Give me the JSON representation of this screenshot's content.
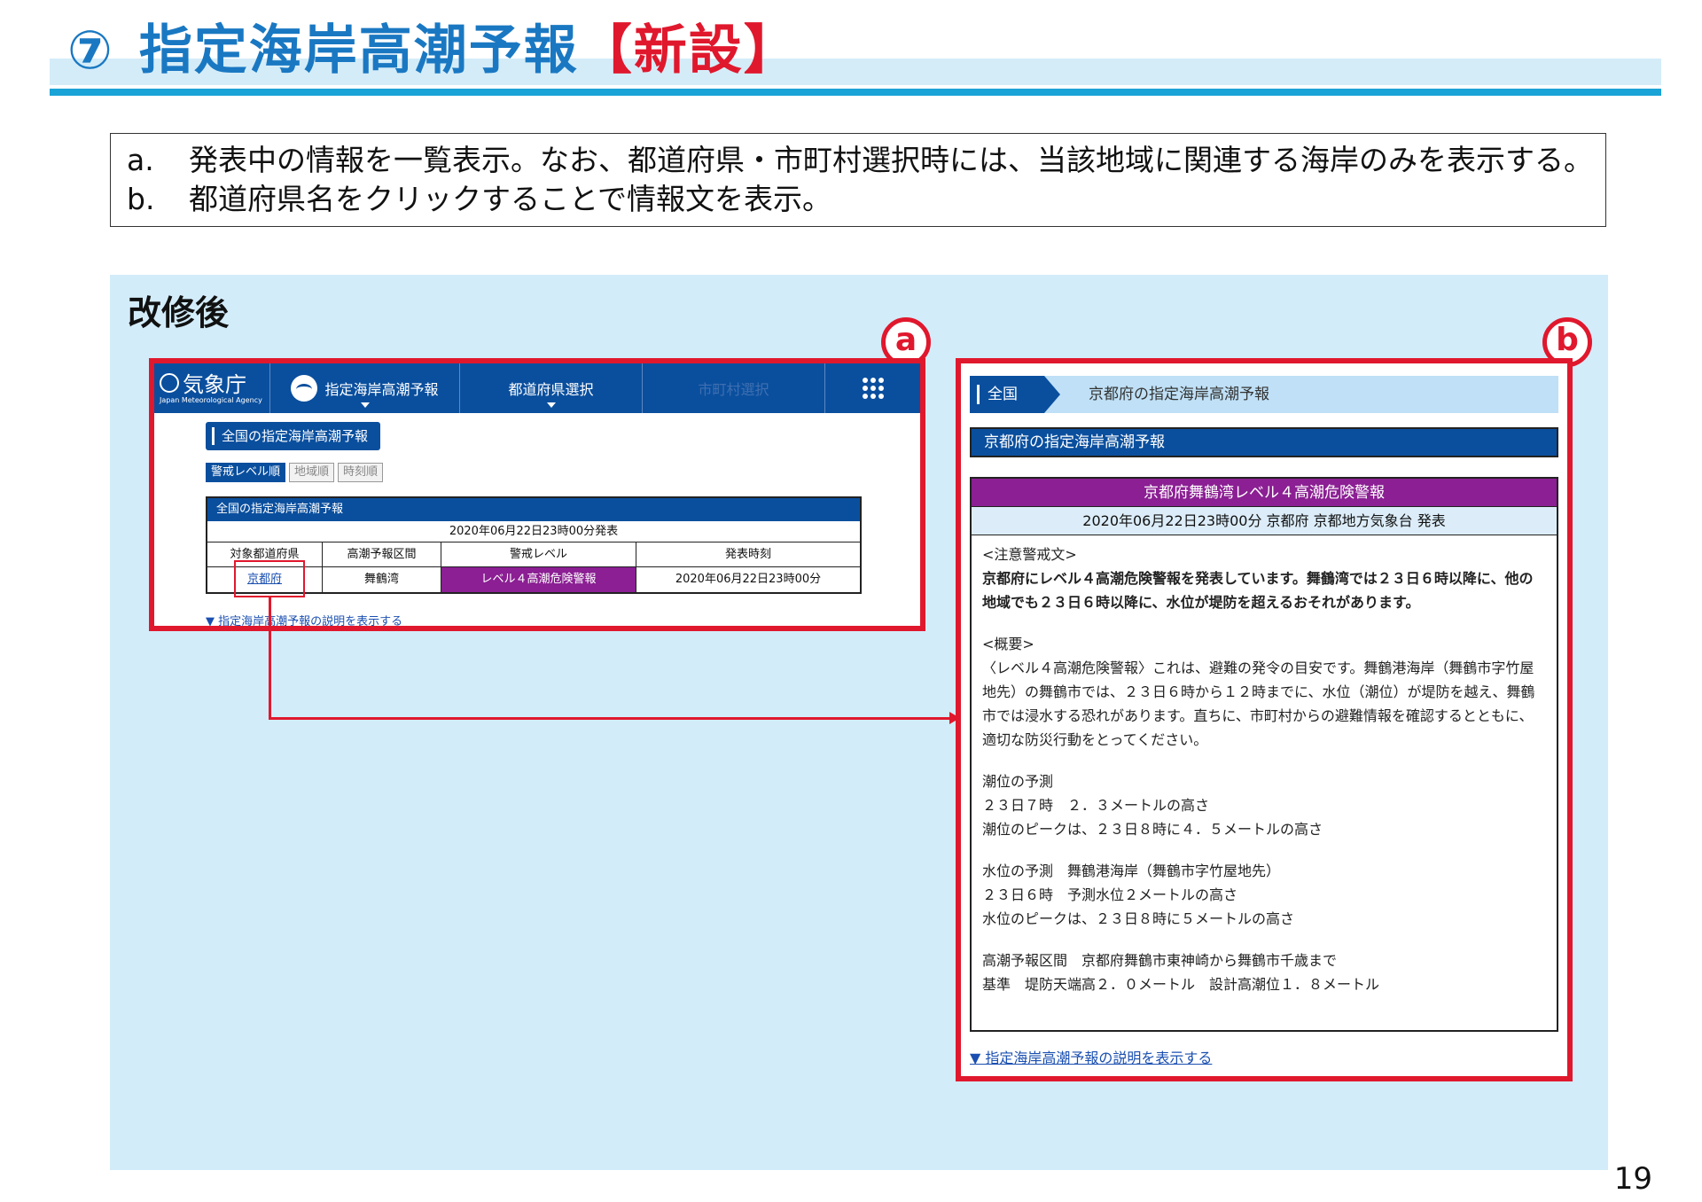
{
  "header": {
    "number": "⑦",
    "title": "指定海岸高潮予報",
    "tag": "【新設】"
  },
  "notes": [
    {
      "key": "a.",
      "text": "発表中の情報を一覧表示。なお、都道府県・市町村選択時には、当該地域に関連する海岸のみを表示する。"
    },
    {
      "key": "b.",
      "text": "都道府県名をクリックすることで情報文を表示。"
    }
  ],
  "panel_title": "改修後",
  "markers": {
    "a": "a",
    "b": "b"
  },
  "page_number": "19",
  "shot_a": {
    "logo": {
      "jp": "気象庁",
      "en": "Japan Meteorological Agency"
    },
    "nav": [
      "指定海岸高潮予報",
      "都道府県選択",
      "市町村選択"
    ],
    "heading": "全国の指定海岸高潮予報",
    "sort_buttons": [
      "警戒レベル順",
      "地域順",
      "時刻順"
    ],
    "table": {
      "title": "全国の指定海岸高潮予報",
      "issued": "2020年06月22日23時00分発表",
      "columns": [
        "対象都道府県",
        "高潮予報区間",
        "警戒レベル",
        "発表時刻"
      ],
      "rows": [
        [
          "京都府",
          "舞鶴湾",
          "レベル４高潮危険警報",
          "2020年06月22日23時00分"
        ]
      ]
    },
    "link": "▼ 指定海岸高潮予報の説明を表示する"
  },
  "shot_b": {
    "breadcrumb": {
      "root": "全国",
      "current": "京都府の指定海岸高潮予報"
    },
    "heading": "京都府の指定海岸高潮予報",
    "box_title": "京都府舞鶴湾レベル４高潮危険警報",
    "box_sub": "2020年06月22日23時00分 京都府 京都地方気象台 発表",
    "warning_label": "<注意警戒文>",
    "warning_text": "京都府にレベル４高潮危険警報を発表しています。舞鶴湾では２３日６時以降に、他の地域でも２３日６時以降に、水位が堤防を超えるおそれがあります。",
    "summary_label": "<概要>",
    "summary_text": "〈レベル４高潮危険警報〉これは、避難の発令の目安です。舞鶴港海岸（舞鶴市字竹屋地先）の舞鶴市では、２３日６時から１２時までに、水位（潮位）が堤防を越え、舞鶴市では浸水する恐れがあります。直ちに、市町村からの避難情報を確認するとともに、適切な防災行動をとってください。",
    "tide_lines": [
      "潮位の予測",
      "２３日７時　２．３メートルの高さ",
      "潮位のピークは、２３日８時に４．５メートルの高さ"
    ],
    "water_lines": [
      "水位の予測　舞鶴港海岸（舞鶴市字竹屋地先）",
      "２３日６時　予測水位２メートルの高さ",
      "水位のピークは、２３日８時に５メートルの高さ"
    ],
    "section_lines": [
      "高潮予報区間　京都府舞鶴市東神崎から舞鶴市千歳まで",
      "基準　堤防天端高２．０メートル　設計高潮位１．８メートル"
    ],
    "link": "▼ 指定海岸高潮予報の説明を表示する"
  },
  "colors": {
    "brand_blue": "#0a4f9e",
    "title_blue": "#1a78c2",
    "accent_red": "#e0182d",
    "warning_purple": "#8b1f93",
    "panel_bg": "#d3ecfa"
  }
}
